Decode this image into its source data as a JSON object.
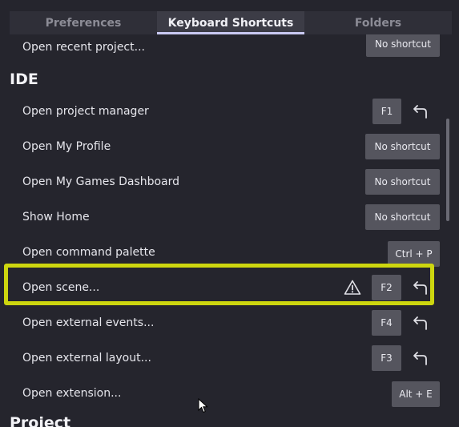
{
  "tabs": [
    {
      "label": "Preferences"
    },
    {
      "label": "Keyboard Shortcuts"
    },
    {
      "label": "Folders"
    }
  ],
  "active_tab": "Keyboard Shortcuts",
  "rows_top": [
    {
      "label": "Open recent project...",
      "shortcut": "No shortcut"
    }
  ],
  "sections": [
    {
      "title": "IDE"
    },
    {
      "title": "Project"
    }
  ],
  "ide_rows": [
    {
      "label": "Open project manager",
      "shortcut": "F1",
      "reset_icon": "undo-arrow-icon"
    },
    {
      "label": "Open My Profile",
      "shortcut": "No shortcut"
    },
    {
      "label": "Open My Games Dashboard",
      "shortcut": "No shortcut"
    },
    {
      "label": "Show Home",
      "shortcut": "No shortcut"
    },
    {
      "label": "Open command palette",
      "shortcut": "Ctrl + P"
    },
    {
      "label": "Open scene...",
      "shortcut": "F2",
      "warning_icon": "warning-triangle-icon",
      "reset_icon": "undo-arrow-icon"
    },
    {
      "label": "Open external events...",
      "shortcut": "F4",
      "reset_icon": "undo-arrow-icon"
    },
    {
      "label": "Open external layout...",
      "shortcut": "F3",
      "reset_icon": "undo-arrow-icon"
    },
    {
      "label": "Open extension...",
      "shortcut": "Alt + E"
    }
  ],
  "colors": {
    "background": "#25252d",
    "button": "#55555e",
    "highlight": "#cdd60f",
    "active_tab_underline": "#c9c9f2"
  }
}
